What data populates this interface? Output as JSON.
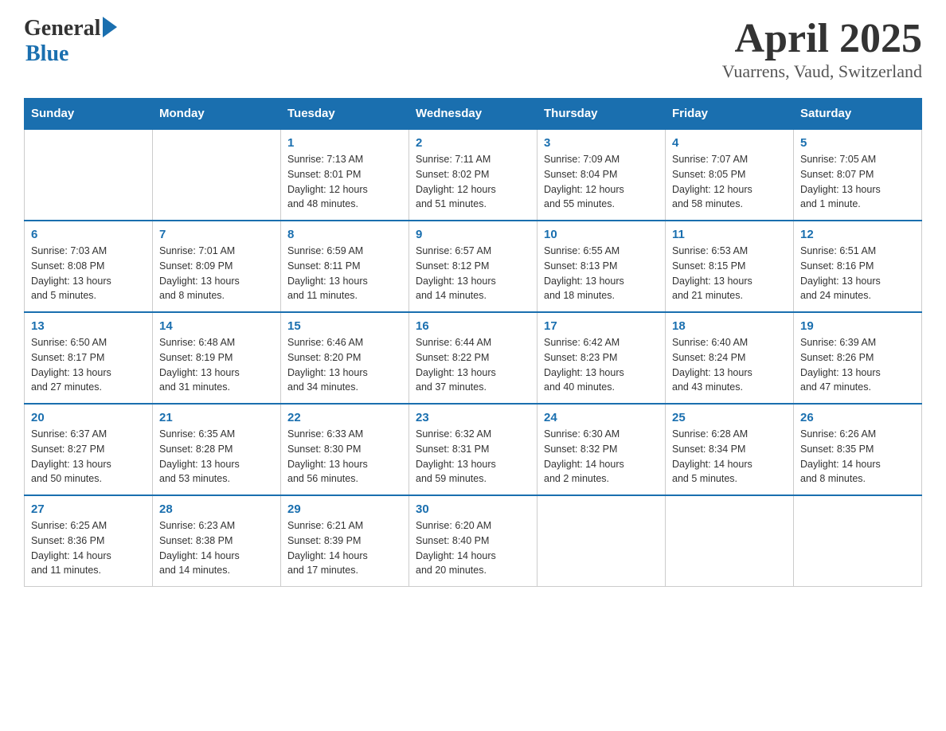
{
  "logo": {
    "general": "General",
    "blue": "Blue"
  },
  "title": {
    "month_year": "April 2025",
    "location": "Vuarrens, Vaud, Switzerland"
  },
  "weekdays": [
    "Sunday",
    "Monday",
    "Tuesday",
    "Wednesday",
    "Thursday",
    "Friday",
    "Saturday"
  ],
  "weeks": [
    [
      {
        "day": "",
        "info": ""
      },
      {
        "day": "",
        "info": ""
      },
      {
        "day": "1",
        "info": "Sunrise: 7:13 AM\nSunset: 8:01 PM\nDaylight: 12 hours\nand 48 minutes."
      },
      {
        "day": "2",
        "info": "Sunrise: 7:11 AM\nSunset: 8:02 PM\nDaylight: 12 hours\nand 51 minutes."
      },
      {
        "day": "3",
        "info": "Sunrise: 7:09 AM\nSunset: 8:04 PM\nDaylight: 12 hours\nand 55 minutes."
      },
      {
        "day": "4",
        "info": "Sunrise: 7:07 AM\nSunset: 8:05 PM\nDaylight: 12 hours\nand 58 minutes."
      },
      {
        "day": "5",
        "info": "Sunrise: 7:05 AM\nSunset: 8:07 PM\nDaylight: 13 hours\nand 1 minute."
      }
    ],
    [
      {
        "day": "6",
        "info": "Sunrise: 7:03 AM\nSunset: 8:08 PM\nDaylight: 13 hours\nand 5 minutes."
      },
      {
        "day": "7",
        "info": "Sunrise: 7:01 AM\nSunset: 8:09 PM\nDaylight: 13 hours\nand 8 minutes."
      },
      {
        "day": "8",
        "info": "Sunrise: 6:59 AM\nSunset: 8:11 PM\nDaylight: 13 hours\nand 11 minutes."
      },
      {
        "day": "9",
        "info": "Sunrise: 6:57 AM\nSunset: 8:12 PM\nDaylight: 13 hours\nand 14 minutes."
      },
      {
        "day": "10",
        "info": "Sunrise: 6:55 AM\nSunset: 8:13 PM\nDaylight: 13 hours\nand 18 minutes."
      },
      {
        "day": "11",
        "info": "Sunrise: 6:53 AM\nSunset: 8:15 PM\nDaylight: 13 hours\nand 21 minutes."
      },
      {
        "day": "12",
        "info": "Sunrise: 6:51 AM\nSunset: 8:16 PM\nDaylight: 13 hours\nand 24 minutes."
      }
    ],
    [
      {
        "day": "13",
        "info": "Sunrise: 6:50 AM\nSunset: 8:17 PM\nDaylight: 13 hours\nand 27 minutes."
      },
      {
        "day": "14",
        "info": "Sunrise: 6:48 AM\nSunset: 8:19 PM\nDaylight: 13 hours\nand 31 minutes."
      },
      {
        "day": "15",
        "info": "Sunrise: 6:46 AM\nSunset: 8:20 PM\nDaylight: 13 hours\nand 34 minutes."
      },
      {
        "day": "16",
        "info": "Sunrise: 6:44 AM\nSunset: 8:22 PM\nDaylight: 13 hours\nand 37 minutes."
      },
      {
        "day": "17",
        "info": "Sunrise: 6:42 AM\nSunset: 8:23 PM\nDaylight: 13 hours\nand 40 minutes."
      },
      {
        "day": "18",
        "info": "Sunrise: 6:40 AM\nSunset: 8:24 PM\nDaylight: 13 hours\nand 43 minutes."
      },
      {
        "day": "19",
        "info": "Sunrise: 6:39 AM\nSunset: 8:26 PM\nDaylight: 13 hours\nand 47 minutes."
      }
    ],
    [
      {
        "day": "20",
        "info": "Sunrise: 6:37 AM\nSunset: 8:27 PM\nDaylight: 13 hours\nand 50 minutes."
      },
      {
        "day": "21",
        "info": "Sunrise: 6:35 AM\nSunset: 8:28 PM\nDaylight: 13 hours\nand 53 minutes."
      },
      {
        "day": "22",
        "info": "Sunrise: 6:33 AM\nSunset: 8:30 PM\nDaylight: 13 hours\nand 56 minutes."
      },
      {
        "day": "23",
        "info": "Sunrise: 6:32 AM\nSunset: 8:31 PM\nDaylight: 13 hours\nand 59 minutes."
      },
      {
        "day": "24",
        "info": "Sunrise: 6:30 AM\nSunset: 8:32 PM\nDaylight: 14 hours\nand 2 minutes."
      },
      {
        "day": "25",
        "info": "Sunrise: 6:28 AM\nSunset: 8:34 PM\nDaylight: 14 hours\nand 5 minutes."
      },
      {
        "day": "26",
        "info": "Sunrise: 6:26 AM\nSunset: 8:35 PM\nDaylight: 14 hours\nand 8 minutes."
      }
    ],
    [
      {
        "day": "27",
        "info": "Sunrise: 6:25 AM\nSunset: 8:36 PM\nDaylight: 14 hours\nand 11 minutes."
      },
      {
        "day": "28",
        "info": "Sunrise: 6:23 AM\nSunset: 8:38 PM\nDaylight: 14 hours\nand 14 minutes."
      },
      {
        "day": "29",
        "info": "Sunrise: 6:21 AM\nSunset: 8:39 PM\nDaylight: 14 hours\nand 17 minutes."
      },
      {
        "day": "30",
        "info": "Sunrise: 6:20 AM\nSunset: 8:40 PM\nDaylight: 14 hours\nand 20 minutes."
      },
      {
        "day": "",
        "info": ""
      },
      {
        "day": "",
        "info": ""
      },
      {
        "day": "",
        "info": ""
      }
    ]
  ]
}
